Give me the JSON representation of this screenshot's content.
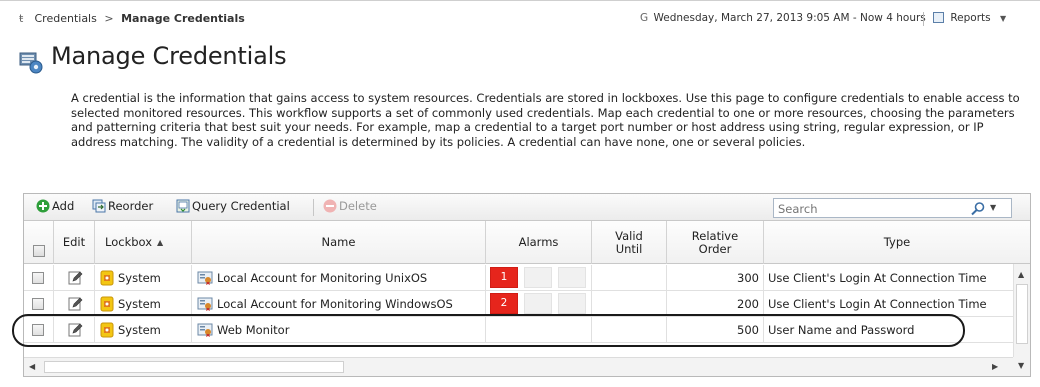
{
  "breadcrumb": {
    "parent": "Credentials",
    "separator": ">",
    "current": "Manage Credentials"
  },
  "header": {
    "datetime": "Wednesday, March 27, 2013 9:05 AM - Now 4 hours",
    "reports_label": "Reports"
  },
  "page": {
    "title": "Manage Credentials",
    "description": "A credential is the information that gains access to system resources. Credentials are stored in lockboxes. Use this page to configure credentials to enable access to selected monitored resources. This workflow supports a set of commonly used credentials. Map each credential to one or more resources, choosing the parameters and patterning criteria that best suit your needs. For example, map a credential to a target port number or host address using string, regular expression, or IP address matching. The validity of a credential is determined by its policies. A credential can have none, one or several policies."
  },
  "toolbar": {
    "add_label": "Add",
    "reorder_label": "Reorder",
    "query_label": "Query Credential",
    "delete_label": "Delete",
    "search_placeholder": "Search"
  },
  "columns": {
    "edit": "Edit",
    "lockbox": "Lockbox",
    "name": "Name",
    "alarms": "Alarms",
    "valid_until": "Valid Until",
    "relative_order": "Relative Order",
    "type": "Type"
  },
  "rows": [
    {
      "lockbox": "System",
      "name": "Local Account for Monitoring UnixOS",
      "alarm_count": "1",
      "valid_until": "",
      "relative_order": "300",
      "type": "Use Client's Login At Connection Time"
    },
    {
      "lockbox": "System",
      "name": "Local Account for Monitoring WindowsOS",
      "alarm_count": "2",
      "valid_until": "",
      "relative_order": "200",
      "type": "Use Client's Login At Connection Time"
    },
    {
      "lockbox": "System",
      "name": "Web Monitor",
      "alarm_count": "",
      "valid_until": "",
      "relative_order": "500",
      "type": "User Name and Password"
    }
  ],
  "colors": {
    "alarm_red": "#e6251c",
    "add_green": "#2e9e3a",
    "lockbox_yellow": "#f3c613"
  },
  "icons": {
    "page": "credentials-icon",
    "add": "add-icon",
    "reorder": "reorder-icon",
    "query": "query-icon",
    "delete": "delete-icon",
    "search": "search-icon",
    "edit": "edit-icon",
    "lockbox": "lockbox-icon",
    "credential": "credential-icon"
  }
}
